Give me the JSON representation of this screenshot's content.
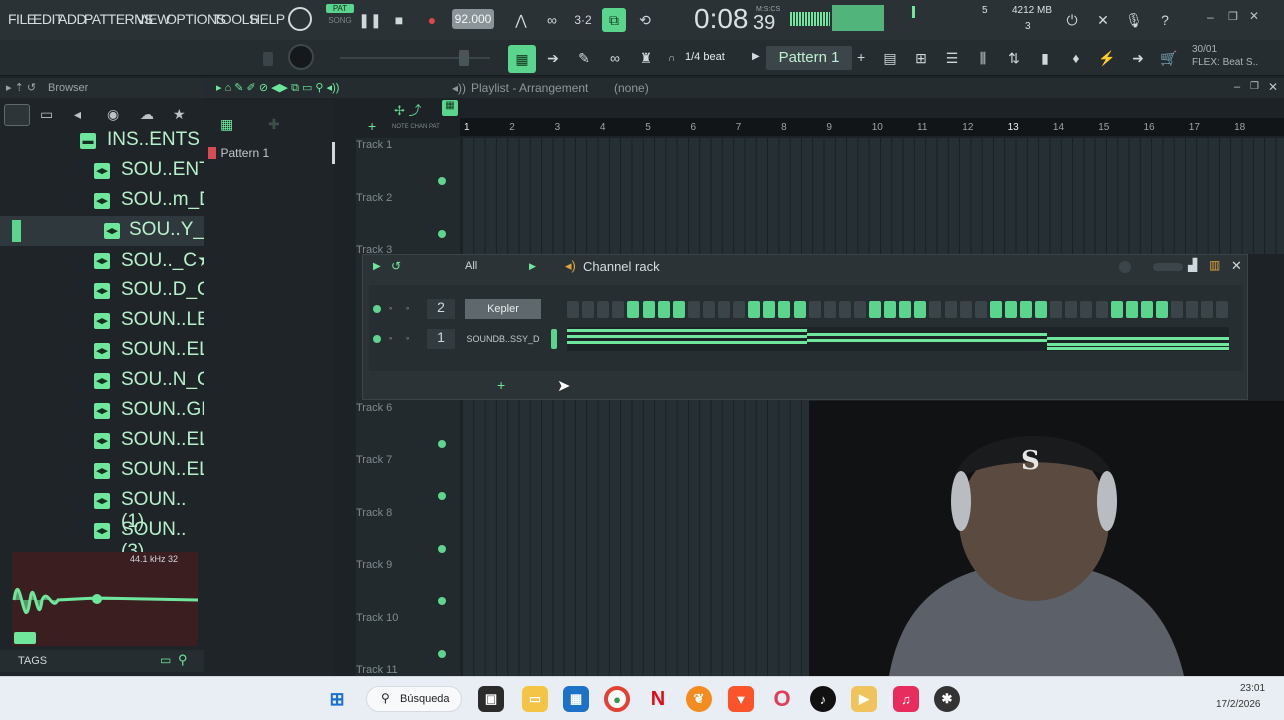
{
  "menu": {
    "file": "FILE",
    "edit": "EDIT",
    "add": "ADD",
    "patterns": "PATTERNS",
    "view": "VIEW",
    "options": "OPTIONS",
    "tools": "TOOLS",
    "help": "HELP"
  },
  "mode": {
    "pat": "PAT",
    "song": "SONG"
  },
  "tempo": "92.000",
  "time": {
    "main": "0:08",
    "sub": "39",
    "label": "M:S:CS"
  },
  "cpu": {
    "value": "5",
    "mem": "4212 MB",
    "voices": "3"
  },
  "snap": "1/4 beat",
  "pattern_selector": "Pattern 1",
  "hint": {
    "line1": "30/01",
    "line2": "FLEX: Beat S.."
  },
  "browser": {
    "title": "Browser",
    "items": [
      {
        "label": "INS..ENTS",
        "type": "folder"
      },
      {
        "label": "SOU..ENT",
        "type": "file"
      },
      {
        "label": "SOU..m_D",
        "type": "file"
      },
      {
        "label": "SOU..Y_D",
        "type": "file"
      },
      {
        "label": "SOU.._C★",
        "type": "file"
      },
      {
        "label": "SOU..D_C",
        "type": "file"
      },
      {
        "label": "SOUN..LET",
        "type": "file"
      },
      {
        "label": "SOUN..ELL",
        "type": "file"
      },
      {
        "label": "SOU..N_C",
        "type": "file"
      },
      {
        "label": "SOUN..GE",
        "type": "file"
      },
      {
        "label": "SOUN..ELL",
        "type": "file"
      },
      {
        "label": "SOUN..ELL",
        "type": "file"
      },
      {
        "label": "SOUN..(1)",
        "type": "file"
      },
      {
        "label": "SOUN..(3)",
        "type": "file"
      }
    ],
    "preview_info": "44.1 kHz 32",
    "tags_label": "TAGS"
  },
  "playlist": {
    "title": "Playlist - Arrangement",
    "selection": "(none)",
    "picker": [
      "Pattern 1"
    ],
    "ruler": [
      "1",
      "2",
      "3",
      "4",
      "5",
      "6",
      "7",
      "8",
      "9",
      "10",
      "11",
      "12",
      "13",
      "14",
      "15",
      "16",
      "17",
      "18"
    ],
    "tracks": [
      "Track 1",
      "Track 2",
      "Track 3",
      "Track 6",
      "Track 7",
      "Track 8",
      "Track 9",
      "Track 10",
      "Track 11"
    ]
  },
  "channel_rack": {
    "title": "Channel rack",
    "filter": "All",
    "channels": [
      {
        "num": "2",
        "name": "Kepler",
        "type": "steps",
        "steps": [
          0,
          0,
          0,
          0,
          1,
          1,
          1,
          1,
          0,
          0,
          0,
          0,
          1,
          1,
          1,
          1,
          0,
          0,
          0,
          0,
          1,
          1,
          1,
          1,
          0,
          0,
          0,
          0,
          1,
          1,
          1,
          1,
          0,
          0,
          0,
          0,
          1,
          1,
          1,
          1,
          0,
          0,
          0,
          0
        ]
      },
      {
        "num": "1",
        "name": "SOUNDB..SSY_D",
        "type": "audio"
      }
    ]
  },
  "taskbar": {
    "search": "Búsqueda",
    "time": "23:01",
    "date": "17/2/2026"
  },
  "colors": {
    "accent": "#5bd58d",
    "panel": "#2a3236",
    "grid": "#262f33"
  }
}
